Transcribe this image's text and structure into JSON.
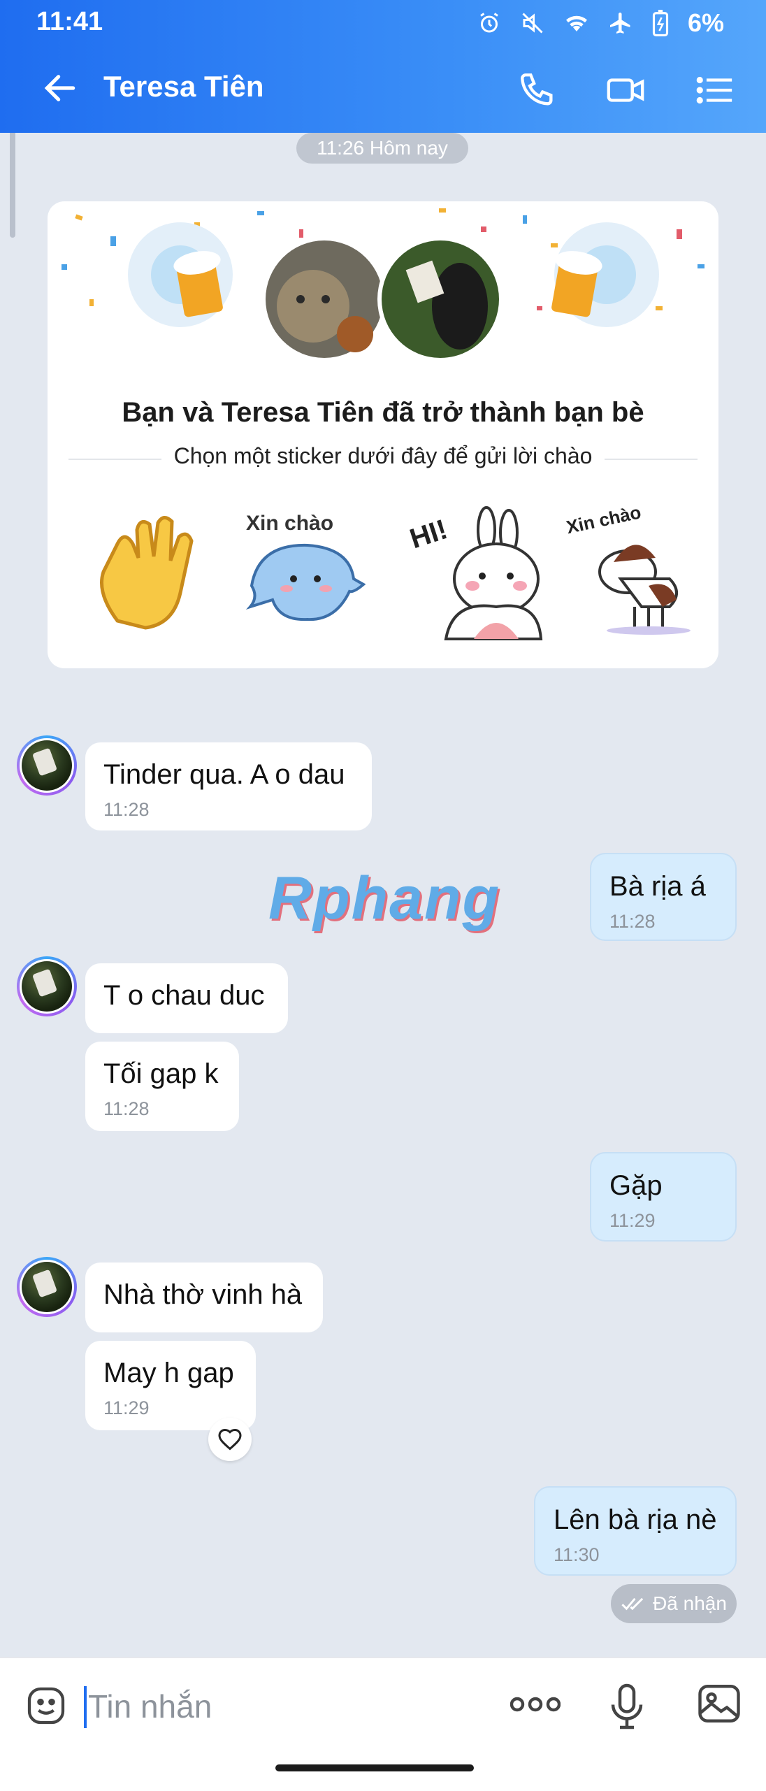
{
  "status_bar": {
    "time": "11:41",
    "battery": "6%"
  },
  "header": {
    "contact_name": "Teresa Tiên"
  },
  "timestamp_pill": "11:26 Hôm nay",
  "friend_card": {
    "headline": "Bạn và Teresa Tiên đã trở thành bạn bè",
    "subline": "Chọn một sticker dưới đây để gửi lời chào",
    "sticker_texts": [
      "Xin chào",
      "HI!",
      "Xin chào"
    ]
  },
  "messages": [
    {
      "side": "in",
      "text": "Tinder qua. A o dau",
      "time": "11:28"
    },
    {
      "side": "out",
      "text": "Bà rịa á",
      "time": "11:28"
    },
    {
      "side": "in",
      "text": "T o chau duc",
      "time": ""
    },
    {
      "side": "in",
      "text": "Tối gap k",
      "time": "11:28"
    },
    {
      "side": "out",
      "text": "Gặp",
      "time": "11:29"
    },
    {
      "side": "in",
      "text": "Nhà thờ vinh hà",
      "time": ""
    },
    {
      "side": "in",
      "text": "May h gap",
      "time": "11:29"
    },
    {
      "side": "out",
      "text": "Lên bà rịa nè",
      "time": "11:30"
    }
  ],
  "watermark": "Rphang",
  "delivery_status": "Đã nhận",
  "composer": {
    "placeholder": "Tin nhắn"
  },
  "colors": {
    "header_start": "#1f6df0",
    "header_end": "#55a6fb",
    "out_bubble": "#d6ecfd",
    "background": "#e3e8f0"
  }
}
